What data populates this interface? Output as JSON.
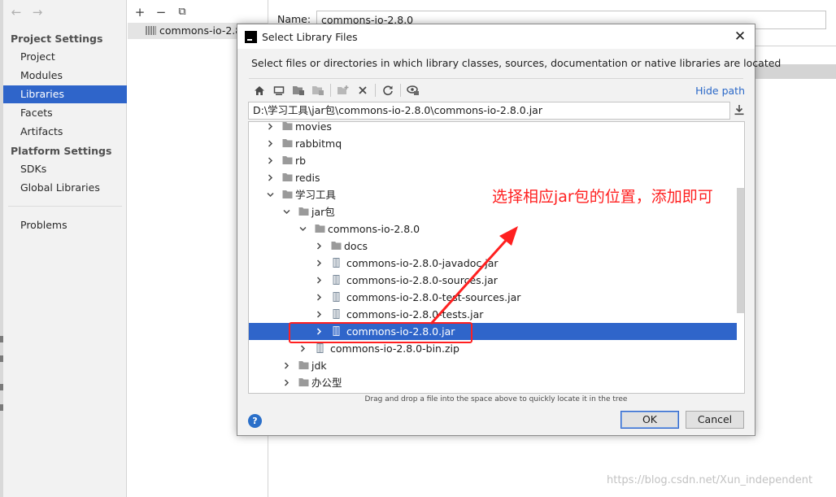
{
  "sidebar": {
    "sections": [
      "Project Settings",
      "Platform Settings"
    ],
    "items": [
      {
        "label": "Project"
      },
      {
        "label": "Modules"
      },
      {
        "label": "Libraries",
        "selected": true
      },
      {
        "label": "Facets"
      },
      {
        "label": "Artifacts"
      },
      {
        "label": "SDKs"
      },
      {
        "label": "Global Libraries"
      },
      {
        "label": "Problems"
      }
    ]
  },
  "library_list": {
    "item": "commons-io-2.8"
  },
  "name_field": {
    "label": "Name:",
    "value": "commons-io-2.8.0"
  },
  "dialog": {
    "title": "Select Library Files",
    "description": "Select files or directories in which library classes, sources, documentation or native libraries are located",
    "hide_path": "Hide path",
    "path": "D:\\学习工具\\jar包\\commons-io-2.8.0\\commons-io-2.8.0.jar",
    "drag_hint": "Drag and drop a file into the space above to quickly locate it in the tree",
    "ok": "OK",
    "cancel": "Cancel",
    "help": "?",
    "toolbar_icons": [
      "home-icon",
      "desktop-icon",
      "project-folder-icon",
      "module-folder-icon",
      "new-folder-icon",
      "delete-icon",
      "refresh-icon",
      "show-hidden-icon"
    ],
    "tree": [
      {
        "label": "movies",
        "depth": 0,
        "icon": "folder",
        "expanded": false
      },
      {
        "label": "rabbitmq",
        "depth": 0,
        "icon": "folder",
        "expanded": false
      },
      {
        "label": "rb",
        "depth": 0,
        "icon": "folder",
        "expanded": false
      },
      {
        "label": "redis",
        "depth": 0,
        "icon": "folder",
        "expanded": false
      },
      {
        "label": "学习工具",
        "depth": 0,
        "icon": "folder",
        "expanded": true
      },
      {
        "label": "jar包",
        "depth": 1,
        "icon": "folder",
        "expanded": true
      },
      {
        "label": "commons-io-2.8.0",
        "depth": 2,
        "icon": "folder",
        "expanded": true
      },
      {
        "label": "docs",
        "depth": 3,
        "icon": "folder",
        "expanded": false
      },
      {
        "label": "commons-io-2.8.0-javadoc.jar",
        "depth": 3,
        "icon": "jar",
        "expanded": false
      },
      {
        "label": "commons-io-2.8.0-sources.jar",
        "depth": 3,
        "icon": "jar",
        "expanded": false
      },
      {
        "label": "commons-io-2.8.0-test-sources.jar",
        "depth": 3,
        "icon": "jar",
        "expanded": false
      },
      {
        "label": "commons-io-2.8.0-tests.jar",
        "depth": 3,
        "icon": "jar",
        "expanded": false
      },
      {
        "label": "commons-io-2.8.0.jar",
        "depth": 3,
        "icon": "jar",
        "expanded": false,
        "selected": true
      },
      {
        "label": "commons-io-2.8.0-bin.zip",
        "depth": 2,
        "icon": "jar",
        "expanded": false
      },
      {
        "label": "jdk",
        "depth": 1,
        "icon": "folder",
        "expanded": false
      },
      {
        "label": "办公型",
        "depth": 1,
        "icon": "folder",
        "expanded": false
      }
    ]
  },
  "annotation": {
    "text": "选择相应jar包的位置，添加即可"
  },
  "watermark": "https://blog.csdn.net/Xun_independent",
  "colors": {
    "selection": "#2f65ca",
    "link": "#2a68c8",
    "annotation": "#ff2020"
  }
}
